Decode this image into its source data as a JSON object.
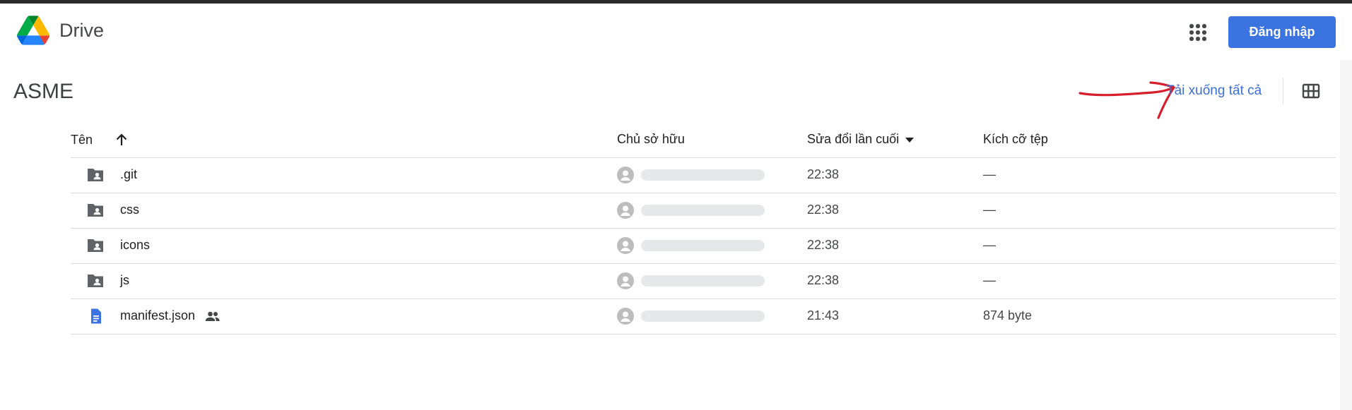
{
  "header": {
    "brand": "Drive",
    "signin_label": "Đăng nhập"
  },
  "folder": {
    "title": "ASME",
    "download_all": "Tải xuống tất cả"
  },
  "columns": {
    "name": "Tên",
    "owner": "Chủ sở hữu",
    "modified": "Sửa đổi lần cuối",
    "size": "Kích cỡ tệp"
  },
  "rows": [
    {
      "name": ".git",
      "type": "shared-folder-icon",
      "modified": "22:38",
      "size": "—"
    },
    {
      "name": "css",
      "type": "shared-folder-icon",
      "modified": "22:38",
      "size": "—"
    },
    {
      "name": "icons",
      "type": "shared-folder-icon",
      "modified": "22:38",
      "size": "—"
    },
    {
      "name": "js",
      "type": "shared-folder-icon",
      "modified": "22:38",
      "size": "—"
    },
    {
      "name": "manifest.json",
      "type": "document-icon",
      "shared": true,
      "modified": "21:43",
      "size": "874 byte"
    }
  ],
  "colors": {
    "accent": "#3b74e0",
    "link": "#3b6fd1",
    "annotation": "#d61f2b"
  }
}
